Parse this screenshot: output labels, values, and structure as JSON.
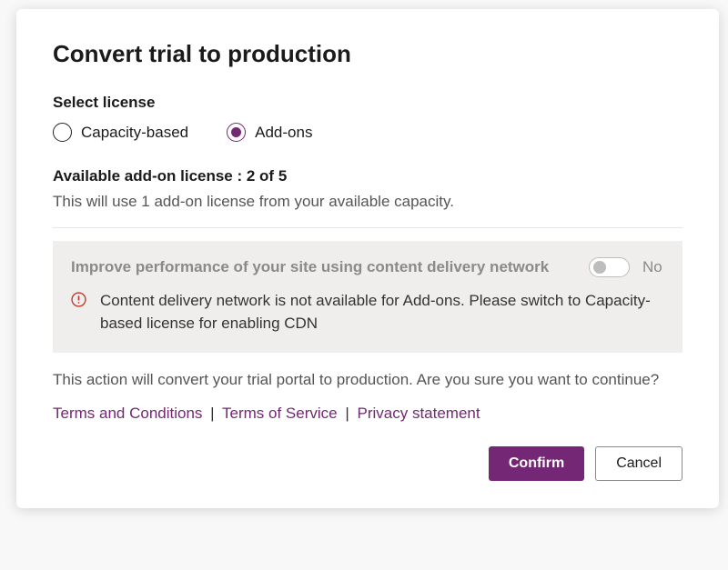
{
  "dialog": {
    "title": "Convert trial to production",
    "selectLicenseLabel": "Select license",
    "radios": {
      "capacity": "Capacity-based",
      "addons": "Add-ons",
      "selected": "addons"
    },
    "availableLine": "Available add-on license : 2 of 5",
    "usageLine": "This will use 1 add-on license from your available capacity.",
    "cdn": {
      "title": "Improve performance of your site using content delivery network",
      "toggleState": "No",
      "message": "Content delivery network is not available for Add-ons. Please switch to Capacity-based license for enabling CDN"
    },
    "confirmText": "This action will convert your trial portal to production. Are you sure you want to continue?",
    "links": {
      "terms": "Terms and Conditions",
      "tos": "Terms of Service",
      "privacy": "Privacy statement",
      "sep": "|"
    },
    "buttons": {
      "confirm": "Confirm",
      "cancel": "Cancel"
    }
  }
}
